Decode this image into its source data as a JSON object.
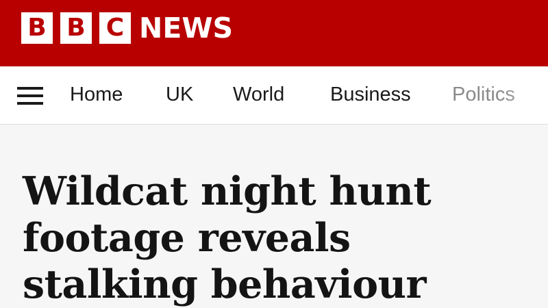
{
  "masthead": {
    "logo_letters": [
      "B",
      "B",
      "C"
    ],
    "logo_word": "NEWS",
    "brand_color": "#b80000"
  },
  "nav": {
    "menu_icon": "hamburger-menu-icon",
    "items": [
      {
        "label": "Home"
      },
      {
        "label": "UK"
      },
      {
        "label": "World"
      },
      {
        "label": "Business"
      },
      {
        "label": "Politics"
      }
    ]
  },
  "article": {
    "headline": "Wildcat night hunt footage reveals stalking behaviour"
  }
}
